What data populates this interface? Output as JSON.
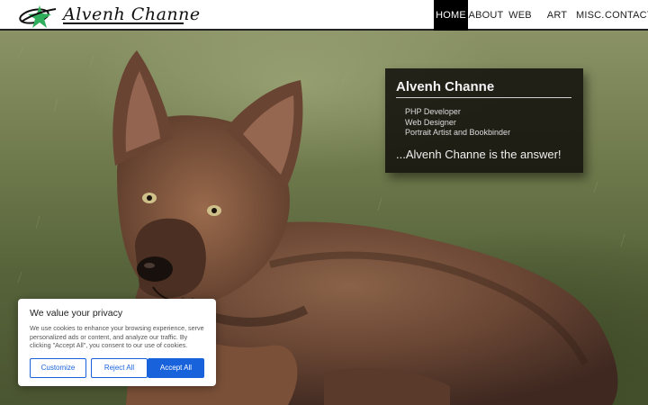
{
  "site": {
    "logo_text": "Alvenh Channe",
    "logo_mark_icon": "green-star-swoosh-icon"
  },
  "nav": {
    "items": [
      {
        "label": "HOME",
        "active": true
      },
      {
        "label": "ABOUT",
        "active": false
      },
      {
        "label": "WEB",
        "active": false
      },
      {
        "label": "ART",
        "active": false
      },
      {
        "label": "MISC.",
        "active": false
      },
      {
        "label": "CONTACT",
        "active": false
      }
    ]
  },
  "intro": {
    "name": "Alvenh Channe",
    "roles": [
      "PHP Developer",
      "Web Designer",
      "Portrait Artist and Bookbinder"
    ],
    "tagline": "...Alvenh Channe is the answer!"
  },
  "cookie": {
    "title": "We value your privacy",
    "text": "We use cookies to enhance your browsing experience, serve personalized ads or content, and analyze our traffic. By clicking \"Accept All\", you consent to our use of cookies.",
    "customize_label": "Customize",
    "reject_label": "Reject All",
    "accept_label": "Accept All"
  },
  "colors": {
    "accent_blue": "#1863dc",
    "nav_active_bg": "#000000",
    "logo_green": "#2fae5b"
  }
}
